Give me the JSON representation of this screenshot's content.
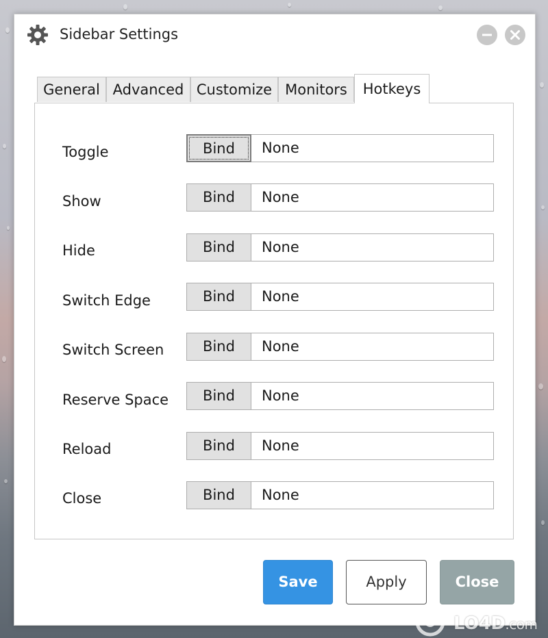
{
  "window": {
    "title": "Sidebar Settings",
    "title_icon": "gear-icon",
    "minimize_icon": "minimize-icon",
    "close_icon": "close-icon"
  },
  "tabs": [
    {
      "label": "General",
      "active": false
    },
    {
      "label": "Advanced",
      "active": false
    },
    {
      "label": "Customize",
      "active": false
    },
    {
      "label": "Monitors",
      "active": false
    },
    {
      "label": "Hotkeys",
      "active": true
    }
  ],
  "hotkeys": [
    {
      "label": "Toggle",
      "button": "Bind",
      "value": "None"
    },
    {
      "label": "Show",
      "button": "Bind",
      "value": "None"
    },
    {
      "label": "Hide",
      "button": "Bind",
      "value": "None"
    },
    {
      "label": "Switch Edge",
      "button": "Bind",
      "value": "None"
    },
    {
      "label": "Switch Screen",
      "button": "Bind",
      "value": "None"
    },
    {
      "label": "Reserve Space",
      "button": "Bind",
      "value": "None"
    },
    {
      "label": "Reload",
      "button": "Bind",
      "value": "None"
    },
    {
      "label": "Close",
      "button": "Bind",
      "value": "None"
    }
  ],
  "footer": {
    "save_label": "Save",
    "apply_label": "Apply",
    "close_label": "Close"
  },
  "watermark": {
    "brand": "LO4D",
    "suffix": ".com"
  },
  "colors": {
    "save_bg": "#3593e3",
    "close_bg": "#95a5a6",
    "window_bg": "#ffffff",
    "tab_bg": "#ececec"
  }
}
